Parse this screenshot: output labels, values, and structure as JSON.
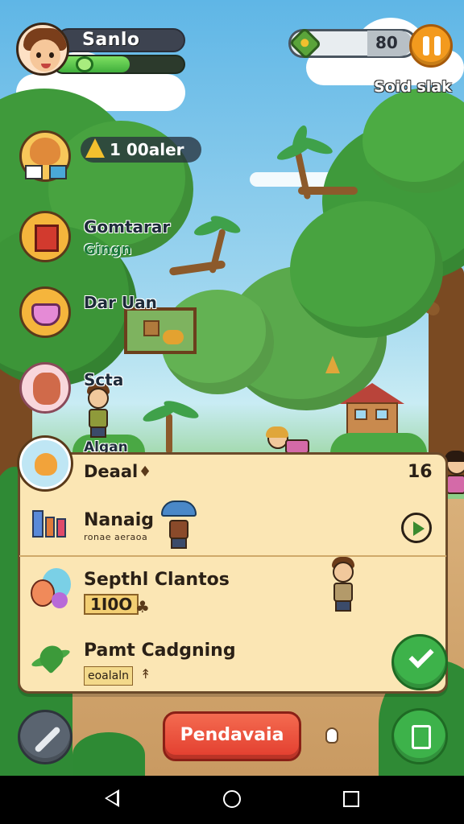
{
  "player": {
    "name": "Sanlo",
    "avatar_icon": "girl-avatar-icon",
    "xp_fraction": 0.58
  },
  "currency": {
    "value": "80",
    "icon": "gem-coin-icon",
    "label": "Soid slak"
  },
  "side_menu": {
    "gold_text": "1 00aler",
    "items": [
      {
        "label": "",
        "icon": "fox-character-icon"
      },
      {
        "label": "Gomtarar",
        "sub": "Gingn",
        "icon": "red-box-icon"
      },
      {
        "label": "Dar Uan",
        "icon": "cooking-pot-icon"
      },
      {
        "label": "Scta",
        "icon": "villager-portrait-icon"
      },
      {
        "label": "Algan",
        "icon": "orange-creature-icon"
      }
    ]
  },
  "quest_panel": {
    "title": "Deaal",
    "title_mark": "♦",
    "count": "16",
    "items": [
      {
        "title": "Nanaig",
        "sub": "ronae aeraoa",
        "icon": "building-blocks-icon"
      },
      {
        "title": "Septhl Clantos",
        "badge": "1I0O",
        "badge_mark": "♣",
        "icon": "blue-friends-icon"
      },
      {
        "title": "Pamt Cadgning",
        "badge": "eoalaln",
        "badge_mark": "↟",
        "icon": "plant-leaf-icon"
      }
    ]
  },
  "buttons": {
    "cta_label": "Pendavaia"
  },
  "colors": {
    "accent_orange": "#f39a1e",
    "cta_red": "#e23d2e",
    "confirm_green": "#3db24a",
    "panel_bg": "#fbe6b4"
  }
}
